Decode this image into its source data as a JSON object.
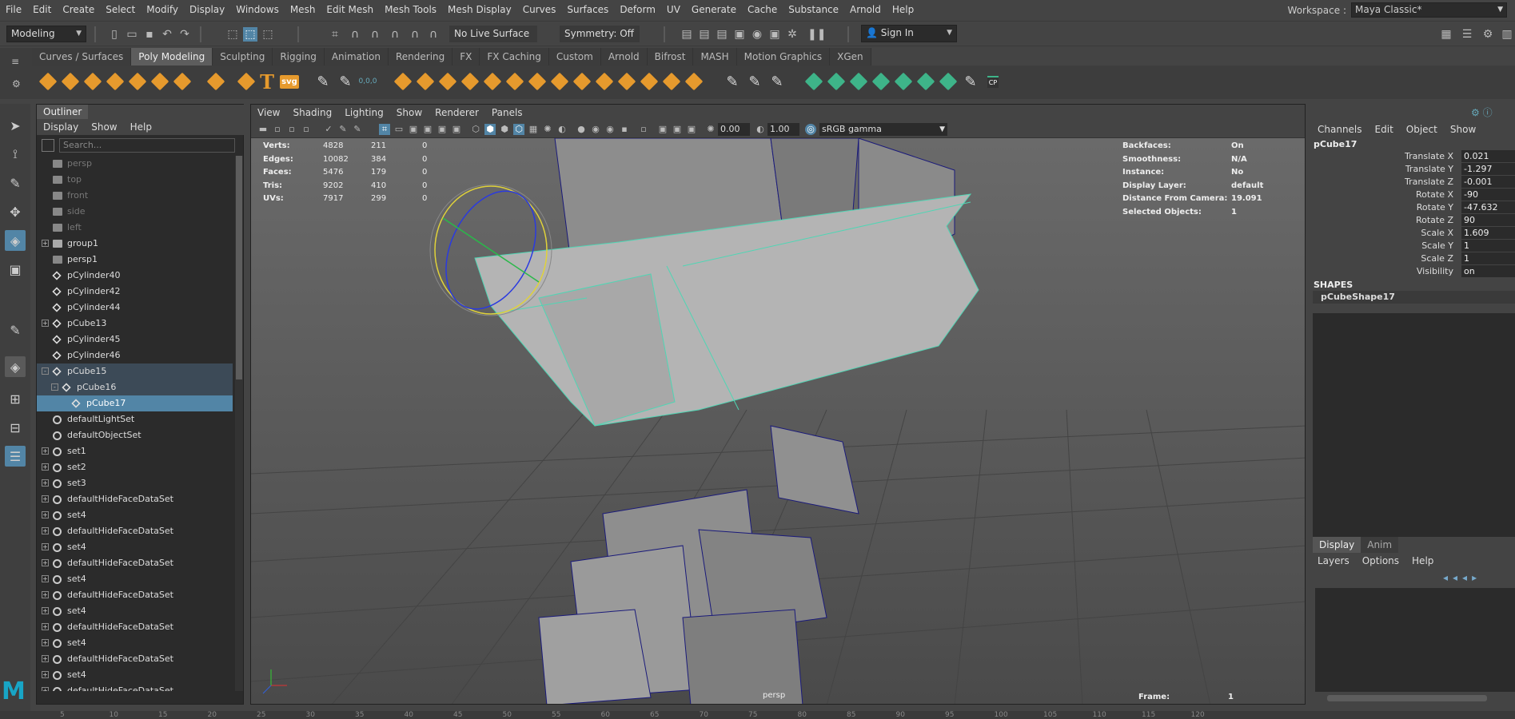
{
  "menubar": {
    "items": [
      "File",
      "Edit",
      "Create",
      "Select",
      "Modify",
      "Display",
      "Windows",
      "Mesh",
      "Edit Mesh",
      "Mesh Tools",
      "Mesh Display",
      "Curves",
      "Surfaces",
      "Deform",
      "UV",
      "Generate",
      "Cache",
      "Substance",
      "Arnold",
      "Help"
    ],
    "workspace_label": "Workspace :",
    "workspace_value": "Maya Classic*"
  },
  "statusline": {
    "mode": "Modeling",
    "live_surface": "No Live Surface",
    "symmetry": "Symmetry: Off",
    "sign_in": "Sign In"
  },
  "shelf": {
    "tabs": [
      "Curves / Surfaces",
      "Poly Modeling",
      "Sculpting",
      "Rigging",
      "Animation",
      "Rendering",
      "FX",
      "FX Caching",
      "Custom",
      "Arnold",
      "Bifrost",
      "MASH",
      "Motion Graphics",
      "XGen"
    ],
    "active_tab": "Poly Modeling",
    "svg_label": "svg",
    "coord_label": "0,0,0",
    "cp_label": "CP"
  },
  "outliner": {
    "title": "Outliner",
    "menu": [
      "Display",
      "Show",
      "Help"
    ],
    "search_placeholder": "Search...",
    "items": [
      {
        "label": "persp",
        "dim": true,
        "indent": 1,
        "icon": "camera-icon"
      },
      {
        "label": "top",
        "dim": true,
        "indent": 1,
        "icon": "camera-icon"
      },
      {
        "label": "front",
        "dim": true,
        "indent": 1,
        "icon": "camera-icon"
      },
      {
        "label": "side",
        "dim": true,
        "indent": 1,
        "icon": "camera-icon"
      },
      {
        "label": "left",
        "dim": true,
        "indent": 1,
        "icon": "camera-icon"
      },
      {
        "label": "group1",
        "indent": 1,
        "icon": "group-icon",
        "expand": "+"
      },
      {
        "label": "persp1",
        "indent": 1,
        "icon": "camera-icon"
      },
      {
        "label": "pCylinder40",
        "indent": 1,
        "icon": "mesh-icon"
      },
      {
        "label": "pCylinder42",
        "indent": 1,
        "icon": "mesh-icon"
      },
      {
        "label": "pCylinder44",
        "indent": 1,
        "icon": "mesh-icon"
      },
      {
        "label": "pCube13",
        "indent": 1,
        "icon": "mesh-icon",
        "expand": "+"
      },
      {
        "label": "pCylinder45",
        "indent": 1,
        "icon": "mesh-icon"
      },
      {
        "label": "pCylinder46",
        "indent": 1,
        "icon": "mesh-icon"
      },
      {
        "label": "pCube15",
        "indent": 1,
        "icon": "mesh-icon",
        "expand": "-",
        "group": true
      },
      {
        "label": "pCube16",
        "indent": 2,
        "icon": "mesh-icon",
        "expand": "-",
        "group": true
      },
      {
        "label": "pCube17",
        "indent": 3,
        "icon": "mesh-icon",
        "selected": true
      },
      {
        "label": "defaultLightSet",
        "indent": 1,
        "icon": "set-icon"
      },
      {
        "label": "defaultObjectSet",
        "indent": 1,
        "icon": "set-icon"
      },
      {
        "label": "set1",
        "indent": 1,
        "icon": "set-icon",
        "expand": "+"
      },
      {
        "label": "set2",
        "indent": 1,
        "icon": "set-icon",
        "expand": "+"
      },
      {
        "label": "set3",
        "indent": 1,
        "icon": "set-icon",
        "expand": "+"
      },
      {
        "label": "defaultHideFaceDataSet",
        "indent": 1,
        "icon": "set-icon",
        "expand": "+"
      },
      {
        "label": "set4",
        "indent": 1,
        "icon": "set-icon",
        "expand": "+"
      },
      {
        "label": "defaultHideFaceDataSet",
        "indent": 1,
        "icon": "set-icon",
        "expand": "+"
      },
      {
        "label": "set4",
        "indent": 1,
        "icon": "set-icon",
        "expand": "+"
      },
      {
        "label": "defaultHideFaceDataSet",
        "indent": 1,
        "icon": "set-icon",
        "expand": "+"
      },
      {
        "label": "set4",
        "indent": 1,
        "icon": "set-icon",
        "expand": "+"
      },
      {
        "label": "defaultHideFaceDataSet",
        "indent": 1,
        "icon": "set-icon",
        "expand": "+"
      },
      {
        "label": "set4",
        "indent": 1,
        "icon": "set-icon",
        "expand": "+"
      },
      {
        "label": "defaultHideFaceDataSet",
        "indent": 1,
        "icon": "set-icon",
        "expand": "+"
      },
      {
        "label": "set4",
        "indent": 1,
        "icon": "set-icon",
        "expand": "+"
      },
      {
        "label": "defaultHideFaceDataSet",
        "indent": 1,
        "icon": "set-icon",
        "expand": "+"
      },
      {
        "label": "set4",
        "indent": 1,
        "icon": "set-icon",
        "expand": "+"
      },
      {
        "label": "defaultHideFaceDataSet",
        "indent": 1,
        "icon": "set-icon",
        "expand": "+"
      }
    ]
  },
  "viewport": {
    "menu": [
      "View",
      "Shading",
      "Lighting",
      "Show",
      "Renderer",
      "Panels"
    ],
    "exposure": "0.00",
    "gamma": "1.00",
    "colorspace": "sRGB gamma",
    "camera_label": "persp",
    "hud_left": [
      {
        "label": "Verts:",
        "a": "4828",
        "b": "211",
        "c": "0"
      },
      {
        "label": "Edges:",
        "a": "10082",
        "b": "384",
        "c": "0"
      },
      {
        "label": "Faces:",
        "a": "5476",
        "b": "179",
        "c": "0"
      },
      {
        "label": "Tris:",
        "a": "9202",
        "b": "410",
        "c": "0"
      },
      {
        "label": "UVs:",
        "a": "7917",
        "b": "299",
        "c": "0"
      }
    ],
    "hud_right": [
      {
        "label": "Backfaces:",
        "value": "On"
      },
      {
        "label": "Smoothness:",
        "value": "N/A"
      },
      {
        "label": "Instance:",
        "value": "No"
      },
      {
        "label": "Display Layer:",
        "value": "default"
      },
      {
        "label": "Distance From Camera:",
        "value": "19.091"
      },
      {
        "label": "Selected Objects:",
        "value": "1"
      }
    ],
    "frame_label": "Frame:",
    "frame_value": "1"
  },
  "channelbox": {
    "menu": [
      "Channels",
      "Edit",
      "Object",
      "Show"
    ],
    "object_name": "pCube17",
    "channels": [
      {
        "label": "Translate X",
        "value": "0.021"
      },
      {
        "label": "Translate Y",
        "value": "-1.297"
      },
      {
        "label": "Translate Z",
        "value": "-0.001"
      },
      {
        "label": "Rotate X",
        "value": "-90"
      },
      {
        "label": "Rotate Y",
        "value": "-47.632"
      },
      {
        "label": "Rotate Z",
        "value": "90"
      },
      {
        "label": "Scale X",
        "value": "1.609"
      },
      {
        "label": "Scale Y",
        "value": "1"
      },
      {
        "label": "Scale Z",
        "value": "1"
      },
      {
        "label": "Visibility",
        "value": "on"
      }
    ],
    "shapes_header": "SHAPES",
    "shape_name": "pCubeShape17"
  },
  "layers": {
    "tabs": [
      "Display",
      "Anim"
    ],
    "menu": [
      "Layers",
      "Options",
      "Help"
    ]
  },
  "timeline": {
    "ticks": [
      "5",
      "10",
      "15",
      "20",
      "25",
      "30",
      "35",
      "40",
      "45",
      "50",
      "55",
      "60",
      "65",
      "70",
      "75",
      "80",
      "85",
      "90",
      "95",
      "100",
      "105",
      "110",
      "115",
      "120"
    ]
  },
  "colors": {
    "selection": "#5285a6",
    "accent_orange": "#e69a2d",
    "accent_teal": "#3eb489",
    "maya_logo": "#18a5c6"
  }
}
